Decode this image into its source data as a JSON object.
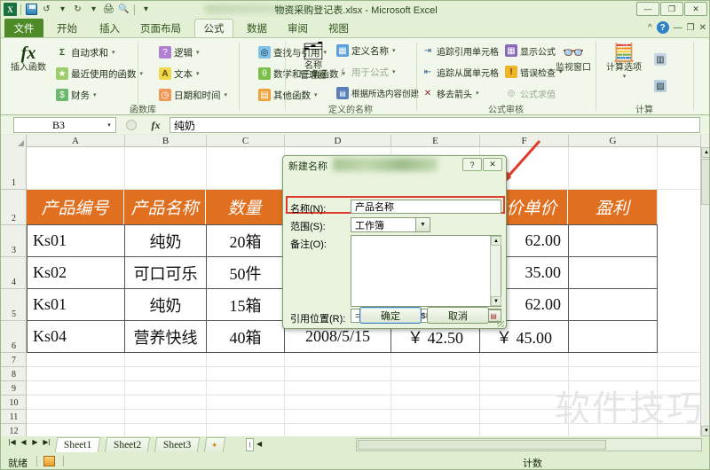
{
  "window": {
    "title": "物资采购登记表.xlsx  -  Microsoft Excel",
    "minimize": "—",
    "restore": "❐",
    "close": "✕"
  },
  "quick_access": {
    "logo": "X",
    "save": "save-icon",
    "undo": "↺",
    "redo": "↻",
    "print": "print-icon",
    "preview": "preview-icon",
    "customize": "▾"
  },
  "ribbon": {
    "tabs": [
      {
        "label": "文件",
        "kind": "file"
      },
      {
        "label": "开始",
        "kind": "normal"
      },
      {
        "label": "插入",
        "kind": "normal"
      },
      {
        "label": "页面布局",
        "kind": "normal"
      },
      {
        "label": "公式",
        "kind": "active"
      },
      {
        "label": "数据",
        "kind": "normal"
      },
      {
        "label": "审阅",
        "kind": "normal"
      },
      {
        "label": "视图",
        "kind": "normal"
      }
    ],
    "help": "?",
    "collapse": "^",
    "win_minimize": "—",
    "win_restore": "❐",
    "win_close": "✕",
    "groups": [
      {
        "name": "函数库",
        "big": {
          "label": "插入函数",
          "icon": "fx"
        },
        "items": [
          {
            "label": "自动求和",
            "icon": "Σ",
            "dropdown": true
          },
          {
            "label": "最近使用的函数",
            "icon": "★",
            "dropdown": true
          },
          {
            "label": "财务",
            "icon": "$",
            "dropdown": true
          },
          {
            "label": "逻辑",
            "icon": "?",
            "dropdown": true
          },
          {
            "label": "文本",
            "icon": "A",
            "dropdown": true
          },
          {
            "label": "日期和时间",
            "icon": "◷",
            "dropdown": true
          },
          {
            "label": "查找与引用",
            "icon": "◎",
            "dropdown": true
          },
          {
            "label": "数学和三角函数",
            "icon": "θ",
            "dropdown": true
          },
          {
            "label": "其他函数",
            "icon": "▤",
            "dropdown": true
          }
        ]
      },
      {
        "name": "定义的名称",
        "big": {
          "label": "名称\n管理器",
          "label1": "名称",
          "label2": "管理器",
          "icon": "▱"
        },
        "items": [
          {
            "label": "定义名称",
            "icon": "▦",
            "dropdown": true,
            "disabled": false
          },
          {
            "label": "用于公式",
            "icon": "ƒ",
            "dropdown": true,
            "disabled": true
          },
          {
            "label": "根据所选内容创建",
            "icon": "▤",
            "dropdown": false,
            "disabled": false
          }
        ]
      },
      {
        "name": "公式审核",
        "items": [
          {
            "label": "追踪引用单元格",
            "icon": "⇥",
            "dropdown": false,
            "disabled": false
          },
          {
            "label": "追踪从属单元格",
            "icon": "⇤",
            "dropdown": false,
            "disabled": false
          },
          {
            "label": "移去箭头",
            "icon": "✕",
            "dropdown": true,
            "disabled": false
          },
          {
            "label": "显示公式",
            "icon": "▦",
            "dropdown": false,
            "disabled": false
          },
          {
            "label": "错误检查",
            "icon": "!",
            "dropdown": true,
            "disabled": false
          },
          {
            "label": "公式求值",
            "icon": "◎",
            "dropdown": false,
            "disabled": true
          }
        ],
        "big": {
          "label": "监视窗口",
          "icon": "▭"
        }
      },
      {
        "name": "计算",
        "big": {
          "label": "计算选项",
          "icon": "▦",
          "dropdown": true
        },
        "items": [
          {
            "label": "",
            "icon": "▥",
            "dropdown": false
          },
          {
            "label": "",
            "icon": "▨",
            "dropdown": false
          }
        ]
      }
    ]
  },
  "formula_bar": {
    "name_box": "B3",
    "name_box_arrow": "▾",
    "cancel": "✕",
    "confirm": "✓",
    "fx": "fx",
    "content": "纯奶"
  },
  "grid": {
    "columns": [
      "A",
      "B",
      "C",
      "D",
      "E",
      "F",
      "G"
    ],
    "rows": [
      "1",
      "2",
      "3",
      "4",
      "5",
      "6",
      "7",
      "8",
      "9",
      "10",
      "11",
      "12"
    ],
    "sheet_title": "物",
    "header_row": [
      "产品编号",
      "产品名称",
      "数量",
      "",
      "",
      "售价单价",
      "盈利"
    ],
    "data_rows": [
      {
        "a": "Ks01",
        "b": "纯奶",
        "c": "20箱",
        "d": "",
        "e": "",
        "f": "62.00",
        "g": ""
      },
      {
        "a": "Ks02",
        "b": "可口可乐",
        "c": "50件",
        "d": "",
        "e": "",
        "f": "35.00",
        "g": ""
      },
      {
        "a": "Ks01",
        "b": "纯奶",
        "c": "15箱",
        "d": "",
        "e": "",
        "f": "62.00",
        "g": ""
      },
      {
        "a": "Ks04",
        "b": "营养快线",
        "c": "40箱",
        "d": "2008/5/15",
        "e": "￥ 42.50",
        "f": "￥    45.00",
        "g": ""
      }
    ],
    "watermark": "软件技巧"
  },
  "dialog": {
    "title": "新建名称",
    "help_btn": "?",
    "close_btn": "✕",
    "fields": [
      {
        "label": "名称(N):",
        "value": "产品名称",
        "type": "text"
      },
      {
        "label": "范围(S):",
        "value": "工作簿",
        "type": "combo"
      },
      {
        "label": "备注(O):",
        "value": "",
        "type": "textarea"
      },
      {
        "label": "引用位置(R):",
        "value": "=Sheet1!$B$3:$B$6",
        "type": "refedit"
      }
    ],
    "ok": "确定",
    "cancel": "取消",
    "highlight_color": "#e03b2a"
  },
  "sheet_tabs": {
    "nav": [
      "|◀",
      "◀",
      "▶",
      "▶|"
    ],
    "tabs": [
      "Sheet1",
      "Sheet2",
      "Sheet3"
    ],
    "new_sheet": "new-sheet-icon"
  },
  "status_bar": {
    "left": "就绪",
    "count_label": "计数"
  }
}
